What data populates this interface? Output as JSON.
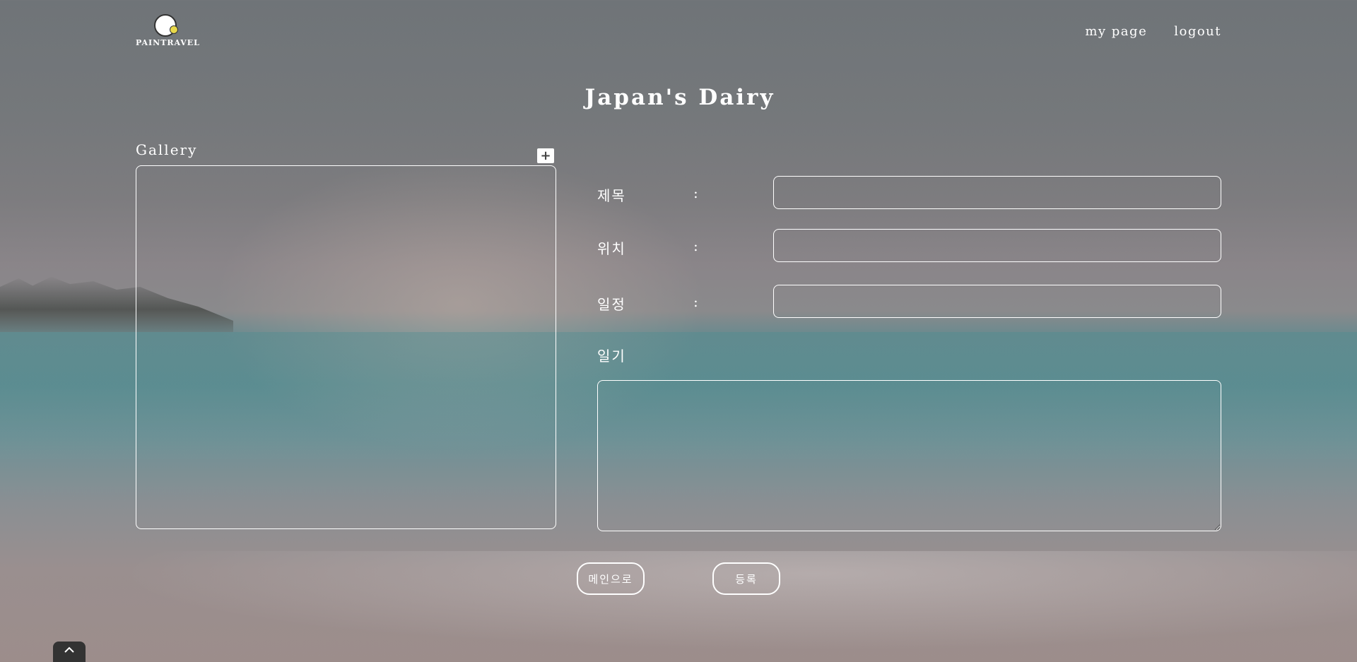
{
  "header": {
    "logo_text": "PAINTRAVEL",
    "nav": [
      {
        "label": "my page"
      },
      {
        "label": "logout"
      }
    ]
  },
  "page": {
    "title": "Japan's Dairy"
  },
  "gallery": {
    "label": "Gallery",
    "add_icon": "plus-icon",
    "add_symbol": "+"
  },
  "form": {
    "fields": [
      {
        "label": "제목",
        "colon": ":",
        "value": ""
      },
      {
        "label": "위치",
        "colon": ":",
        "value": ""
      },
      {
        "label": "일정",
        "colon": ":",
        "value": ""
      }
    ],
    "diary_label": "일기",
    "diary_value": ""
  },
  "buttons": {
    "main_label": "메인으로",
    "register_label": "등록"
  },
  "scroll_top_icon": "chevron-up-icon"
}
